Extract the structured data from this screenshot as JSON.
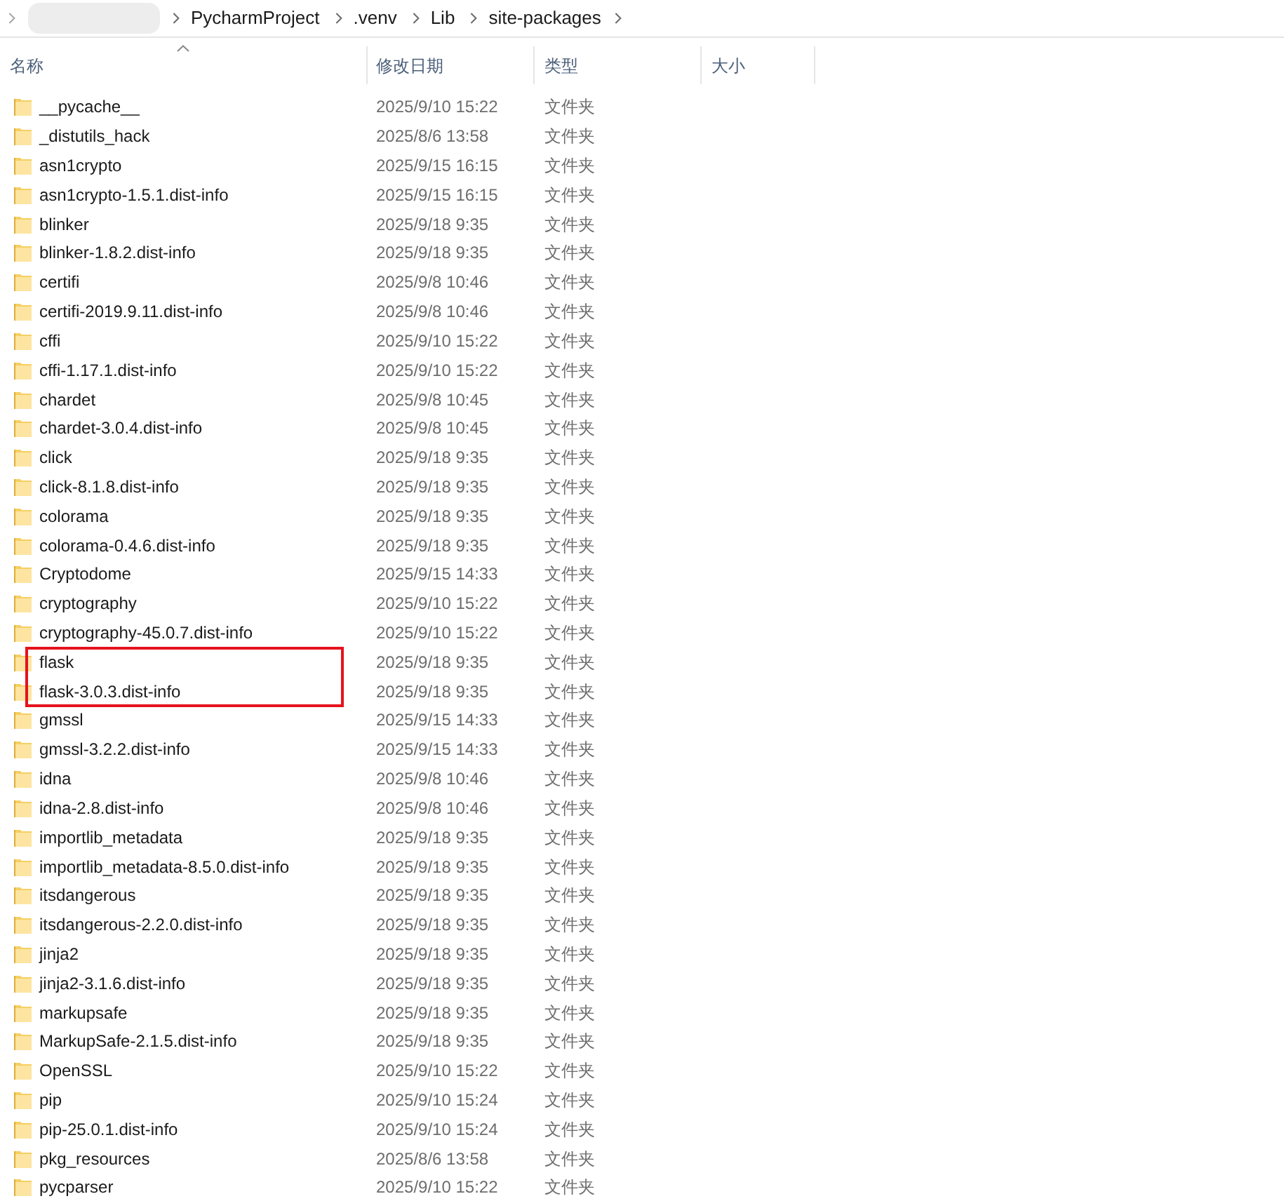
{
  "breadcrumb": {
    "path": [
      "PycharmProject",
      ".venv",
      "Lib",
      "site-packages"
    ]
  },
  "columns": [
    {
      "label": "名称",
      "sorted": true
    },
    {
      "label": "修改日期",
      "sorted": false
    },
    {
      "label": "类型",
      "sorted": false
    },
    {
      "label": "大小",
      "sorted": false
    }
  ],
  "rows": [
    {
      "name": "__pycache__",
      "modified": "2025/9/10 15:22",
      "type": "文件夹",
      "marked": false
    },
    {
      "name": "_distutils_hack",
      "modified": "2025/8/6 13:58",
      "type": "文件夹",
      "marked": false
    },
    {
      "name": "asn1crypto",
      "modified": "2025/9/15 16:15",
      "type": "文件夹",
      "marked": false
    },
    {
      "name": "asn1crypto-1.5.1.dist-info",
      "modified": "2025/9/15 16:15",
      "type": "文件夹",
      "marked": false
    },
    {
      "name": "blinker",
      "modified": "2025/9/18 9:35",
      "type": "文件夹",
      "marked": false
    },
    {
      "name": "blinker-1.8.2.dist-info",
      "modified": "2025/9/18 9:35",
      "type": "文件夹",
      "marked": false
    },
    {
      "name": "certifi",
      "modified": "2025/9/8 10:46",
      "type": "文件夹",
      "marked": false
    },
    {
      "name": "certifi-2019.9.11.dist-info",
      "modified": "2025/9/8 10:46",
      "type": "文件夹",
      "marked": false
    },
    {
      "name": "cffi",
      "modified": "2025/9/10 15:22",
      "type": "文件夹",
      "marked": false
    },
    {
      "name": "cffi-1.17.1.dist-info",
      "modified": "2025/9/10 15:22",
      "type": "文件夹",
      "marked": false
    },
    {
      "name": "chardet",
      "modified": "2025/9/8 10:45",
      "type": "文件夹",
      "marked": false
    },
    {
      "name": "chardet-3.0.4.dist-info",
      "modified": "2025/9/8 10:45",
      "type": "文件夹",
      "marked": false
    },
    {
      "name": "click",
      "modified": "2025/9/18 9:35",
      "type": "文件夹",
      "marked": false
    },
    {
      "name": "click-8.1.8.dist-info",
      "modified": "2025/9/18 9:35",
      "type": "文件夹",
      "marked": false
    },
    {
      "name": "colorama",
      "modified": "2025/9/18 9:35",
      "type": "文件夹",
      "marked": false
    },
    {
      "name": "colorama-0.4.6.dist-info",
      "modified": "2025/9/18 9:35",
      "type": "文件夹",
      "marked": false
    },
    {
      "name": "Cryptodome",
      "modified": "2025/9/15 14:33",
      "type": "文件夹",
      "marked": false
    },
    {
      "name": "cryptography",
      "modified": "2025/9/10 15:22",
      "type": "文件夹",
      "marked": false
    },
    {
      "name": "cryptography-45.0.7.dist-info",
      "modified": "2025/9/10 15:22",
      "type": "文件夹",
      "marked": false
    },
    {
      "name": "flask",
      "modified": "2025/9/18 9:35",
      "type": "文件夹",
      "marked": true
    },
    {
      "name": "flask-3.0.3.dist-info",
      "modified": "2025/9/18 9:35",
      "type": "文件夹",
      "marked": true
    },
    {
      "name": "gmssl",
      "modified": "2025/9/15 14:33",
      "type": "文件夹",
      "marked": false
    },
    {
      "name": "gmssl-3.2.2.dist-info",
      "modified": "2025/9/15 14:33",
      "type": "文件夹",
      "marked": false
    },
    {
      "name": "idna",
      "modified": "2025/9/8 10:46",
      "type": "文件夹",
      "marked": false
    },
    {
      "name": "idna-2.8.dist-info",
      "modified": "2025/9/8 10:46",
      "type": "文件夹",
      "marked": false
    },
    {
      "name": "importlib_metadata",
      "modified": "2025/9/18 9:35",
      "type": "文件夹",
      "marked": false
    },
    {
      "name": "importlib_metadata-8.5.0.dist-info",
      "modified": "2025/9/18 9:35",
      "type": "文件夹",
      "marked": false
    },
    {
      "name": "itsdangerous",
      "modified": "2025/9/18 9:35",
      "type": "文件夹",
      "marked": false
    },
    {
      "name": "itsdangerous-2.2.0.dist-info",
      "modified": "2025/9/18 9:35",
      "type": "文件夹",
      "marked": false
    },
    {
      "name": "jinja2",
      "modified": "2025/9/18 9:35",
      "type": "文件夹",
      "marked": false
    },
    {
      "name": "jinja2-3.1.6.dist-info",
      "modified": "2025/9/18 9:35",
      "type": "文件夹",
      "marked": false
    },
    {
      "name": "markupsafe",
      "modified": "2025/9/18 9:35",
      "type": "文件夹",
      "marked": false
    },
    {
      "name": "MarkupSafe-2.1.5.dist-info",
      "modified": "2025/9/18 9:35",
      "type": "文件夹",
      "marked": false
    },
    {
      "name": "OpenSSL",
      "modified": "2025/9/10 15:22",
      "type": "文件夹",
      "marked": false
    },
    {
      "name": "pip",
      "modified": "2025/9/10 15:24",
      "type": "文件夹",
      "marked": false
    },
    {
      "name": "pip-25.0.1.dist-info",
      "modified": "2025/9/10 15:24",
      "type": "文件夹",
      "marked": false
    },
    {
      "name": "pkg_resources",
      "modified": "2025/8/6 13:58",
      "type": "文件夹",
      "marked": false
    },
    {
      "name": "pycparser",
      "modified": "2025/9/10 15:22",
      "type": "文件夹",
      "marked": false
    }
  ]
}
